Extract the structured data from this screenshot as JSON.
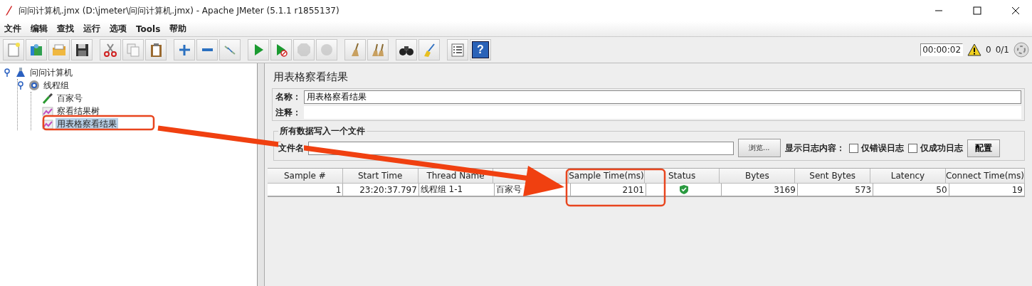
{
  "window": {
    "title": "问问计算机.jmx (D:\\jmeter\\问问计算机.jmx) - Apache JMeter (5.1.1 r1855137)"
  },
  "menu": [
    "文件",
    "编辑",
    "查找",
    "运行",
    "选项",
    "Tools",
    "帮助"
  ],
  "toolbar": {
    "groups": [
      [
        {
          "kind": "new",
          "disabled": false
        },
        {
          "kind": "templates",
          "disabled": false
        },
        {
          "kind": "open",
          "disabled": false
        },
        {
          "kind": "save",
          "disabled": false
        }
      ],
      [
        {
          "kind": "cut",
          "disabled": false
        },
        {
          "kind": "copy",
          "disabled": false
        },
        {
          "kind": "paste",
          "disabled": false
        }
      ],
      [
        {
          "kind": "expand",
          "disabled": false
        },
        {
          "kind": "collapse",
          "disabled": false
        },
        {
          "kind": "toggle",
          "disabled": false
        }
      ],
      [
        {
          "kind": "start",
          "disabled": false
        },
        {
          "kind": "start_no_pause",
          "disabled": false
        },
        {
          "kind": "stop",
          "disabled": true
        },
        {
          "kind": "shutdown",
          "disabled": true
        }
      ],
      [
        {
          "kind": "clear",
          "disabled": false
        },
        {
          "kind": "clear_all",
          "disabled": false
        }
      ],
      [
        {
          "kind": "search",
          "disabled": false
        },
        {
          "kind": "reset_search",
          "disabled": false
        }
      ],
      [
        {
          "kind": "functions",
          "disabled": false
        },
        {
          "kind": "help",
          "disabled": false,
          "label": "?"
        }
      ]
    ],
    "timer": "00:00:02",
    "warnings": "0",
    "threads": "0/1"
  },
  "tree": [
    {
      "label": "问问计算机",
      "kind": "testplan",
      "expanded": true,
      "selected": false,
      "children": [
        {
          "label": "线程组",
          "kind": "threadgroup",
          "expanded": true,
          "selected": false,
          "children": [
            {
              "label": "百家号",
              "kind": "sampler",
              "selected": false
            },
            {
              "label": "察看结果树",
              "kind": "listener",
              "selected": false
            },
            {
              "label": "用表格察看结果",
              "kind": "listener",
              "selected": true
            }
          ]
        }
      ]
    }
  ],
  "panel": {
    "title": "用表格察看结果",
    "name_label": "名称：",
    "name_value": "用表格察看结果",
    "comment_label": "注释：",
    "file_group": {
      "title": "所有数据写入一个文件",
      "file_label": "文件名",
      "browse_button": "浏览...",
      "log_label": "显示日志内容：",
      "checkboxes": [
        {
          "label": "仅错误日志",
          "checked": false
        },
        {
          "label": "仅成功日志",
          "checked": false
        }
      ],
      "config_button": "配置"
    }
  },
  "table": {
    "columns": [
      "Sample #",
      "Start Time",
      "Thread Name",
      "",
      "Sample Time(ms)",
      "Status",
      "Bytes",
      "Sent Bytes",
      "Latency",
      "Connect Time(ms)"
    ],
    "rows": [
      {
        "cells": [
          "1",
          "23:20:37.797",
          "线程组 1-1",
          "百家号",
          "2101",
          "",
          "3169",
          "573",
          "50",
          "19"
        ],
        "passed": true
      }
    ]
  }
}
